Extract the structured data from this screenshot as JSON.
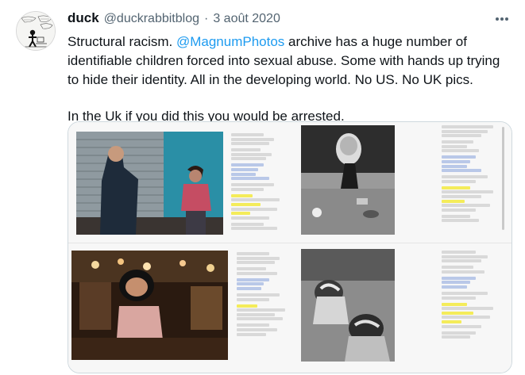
{
  "tweet": {
    "display_name": "duck",
    "handle": "@duckrabbitblog",
    "separator": "·",
    "date": "3 août 2020",
    "more_icon": "more-horizontal-icon",
    "text_line1_pre": "Structural racism. ",
    "mention": "@MagnumPhotos",
    "text_line1_post": " archive has a huge number of identifiable children forced into sexual abuse.  Some with hands up trying to hide their identity. All in the developing world. No US. No UK pics.",
    "text_line2": "In the Uk if you did this you would be arrested."
  },
  "colors": {
    "link": "#1d9bf0",
    "secondary_text": "#536471",
    "highlight": "#f4ec5a"
  }
}
